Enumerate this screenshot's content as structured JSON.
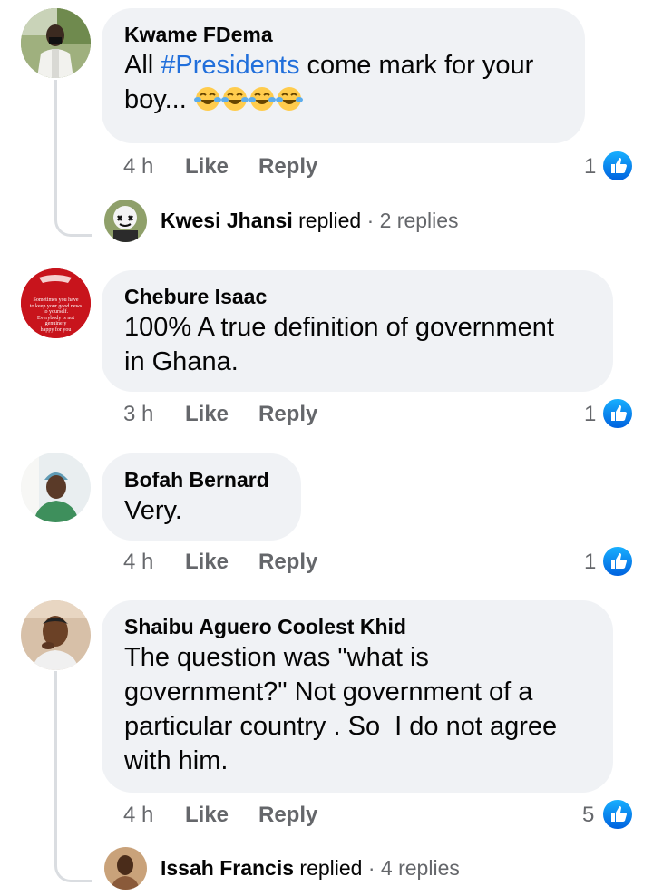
{
  "comments": [
    {
      "author": "Kwame FDema",
      "text_before": "All ",
      "hashtag": "#Presidents",
      "text_after": " come mark for your boy...",
      "emoji": [
        "face-with-tears-of-joy",
        "face-with-tears-of-joy",
        "face-with-tears-of-joy",
        "face-with-tears-of-joy"
      ],
      "time": "4 h",
      "like": "Like",
      "reply": "Reply",
      "reactions": "1",
      "reply_summary": {
        "name": "Kwesi Jhansi",
        "verb": "replied",
        "sep": "·",
        "count": "2 replies"
      }
    },
    {
      "author": "Chebure Isaac",
      "line1": "100% A true definition of government",
      "line2": "in Ghana.",
      "avatar_caption": [
        "Sometimes you have",
        "to keep your good news",
        "to yourself.",
        "Everybody is not",
        "genuinely",
        "happy for you"
      ],
      "time": "3 h",
      "like": "Like",
      "reply": "Reply",
      "reactions": "1"
    },
    {
      "author": "Bofah Bernard",
      "line1": "Very.",
      "time": "4 h",
      "like": "Like",
      "reply": "Reply",
      "reactions": "1"
    },
    {
      "author": "Shaibu Aguero Coolest Khid",
      "line1": "The question was \"what is",
      "line2": "government?\" Not government of a",
      "line3": "particular country . So  I do not agree",
      "line4": "with him.",
      "time": "4 h",
      "like": "Like",
      "reply": "Reply",
      "reactions": "5",
      "reply_summary": {
        "name": "Issah Francis",
        "verb": "replied",
        "sep": "·",
        "count": "4 replies"
      }
    }
  ],
  "colors": {
    "bubble": "#f0f2f5",
    "secondary_text": "#65676b",
    "hashtag": "#216fdb",
    "like_blue": "#1877f2"
  },
  "icons": {
    "reaction": "like-thumb-icon",
    "emoji": "face-with-tears-of-joy"
  }
}
